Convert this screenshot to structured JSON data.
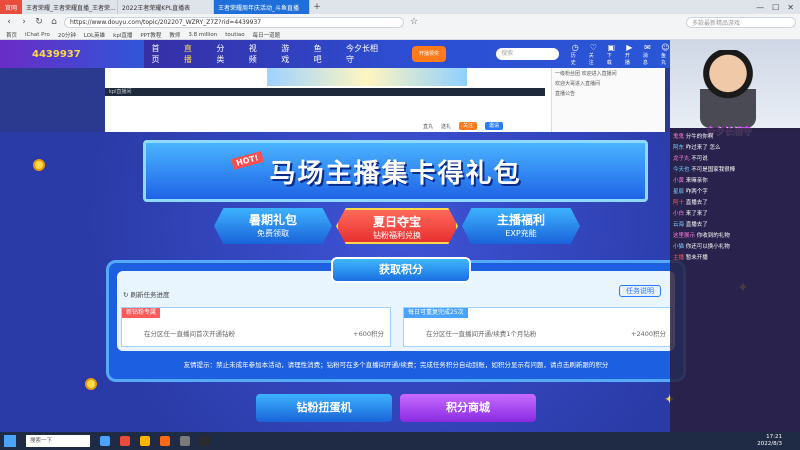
{
  "browser": {
    "logo": "官网",
    "tabs": [
      {
        "label": "王者荣耀_王者荣耀直播_王者荣..."
      },
      {
        "label": "2022王者荣耀KPL直播表"
      },
      {
        "label": "王者荣耀周年庆活动_斗鱼直播",
        "active": true
      }
    ],
    "url": "https://www.douyu.com/topic/202207_WZRY_Z7Z?rid=4439937",
    "search_placeholder": "多款最新精品游戏",
    "bookmarks": [
      "首页",
      "iChat Pro",
      "20分钟",
      "LOL英雄",
      "kpl直播",
      "PPT教程",
      "教师",
      "3.8 million",
      "toutiao",
      "每日一道题"
    ]
  },
  "site": {
    "brand": "4439937",
    "nav": [
      "首页",
      "直播",
      "分类",
      "视频",
      "游戏",
      "鱼吧",
      "今夕长相守"
    ],
    "nav_active": 1,
    "promo": "开播领奖",
    "search_placeholder": "搜索",
    "icons": [
      {
        "glyph": "◷",
        "label": "历史"
      },
      {
        "glyph": "♡",
        "label": "关注"
      },
      {
        "glyph": "▣",
        "label": "下载"
      },
      {
        "glyph": "▶",
        "label": "开播"
      },
      {
        "glyph": "✉",
        "label": "消息"
      },
      {
        "glyph": "☺",
        "label": "鱼丸"
      }
    ]
  },
  "video": {
    "bar_text": "kpl直播间",
    "actions": {
      "count1": "直丸",
      "count2": "送礼",
      "btn1": "关注",
      "btn2": "邀请"
    },
    "chat": [
      "一级粉丝团 欢迎进入直播间",
      "欢迎大哥进入直播间",
      "直播公告"
    ]
  },
  "event": {
    "banner_title": "马场主播集卡得礼包",
    "hot": "HOT!",
    "tabs": [
      {
        "title": "暑期礼包",
        "sub": "免费领取"
      },
      {
        "title": "夏日夺宝",
        "sub": "钻粉福利兑换",
        "selected": true
      },
      {
        "title": "主播福利",
        "sub": "EXP充能"
      }
    ],
    "panel_title": "获取积分",
    "refresh": "刷新任务进度",
    "rules": "任务说明",
    "tasks": [
      {
        "tag": "新钻粉专属",
        "desc": "在分区任一直播间首次开通钻粉",
        "points": "+600积分",
        "tag_color": "#ff5a5a"
      },
      {
        "tag": "每日可重复完成25次",
        "desc": "在分区任一直播间开通/续费1个月钻粉",
        "points": "+2400积分",
        "tag_color": "#4aa3ff"
      }
    ],
    "tip": "友情提示：禁止未成年参加本活动，请理性消费；钻粉可在多个直播间开通/续费；完成任务积分自动到账，如积分显示有问题，请点击刷新跟的积分",
    "bottom_buttons": [
      "钻粉扭蛋机",
      "积分商城"
    ]
  },
  "stream": {
    "cam_title": "今夕长相守",
    "chat": [
      {
        "user": "鬼鬼",
        "text": "分牛的你啊",
        "c": "u"
      },
      {
        "user": "阿东",
        "text": "咋过来了 怎么",
        "c": "u2"
      },
      {
        "user": "龙子丸",
        "text": "不可说",
        "c": "u"
      },
      {
        "user": "今天也",
        "text": "不可是国家我很棒",
        "c": "u2"
      },
      {
        "user": "小黄",
        "text": "来嘛亲你",
        "c": "u"
      },
      {
        "user": "星辰",
        "text": "咋两个字",
        "c": "u2"
      },
      {
        "user": "阿十",
        "text": "直播去了",
        "c": "u3"
      },
      {
        "user": "小白",
        "text": "来了来了",
        "c": "u"
      },
      {
        "user": "云海",
        "text": "直播去了",
        "c": "u2"
      },
      {
        "user": "这里展示",
        "text": "你收到的礼物",
        "c": "u"
      },
      {
        "user": "小猫",
        "text": "你还可以换小礼物",
        "c": "u2"
      },
      {
        "user": "主播",
        "text": "暂未开播",
        "c": "u3"
      }
    ]
  },
  "taskbar": {
    "search": "搜索一下",
    "time": "17:21",
    "date": "2022/8/3"
  }
}
